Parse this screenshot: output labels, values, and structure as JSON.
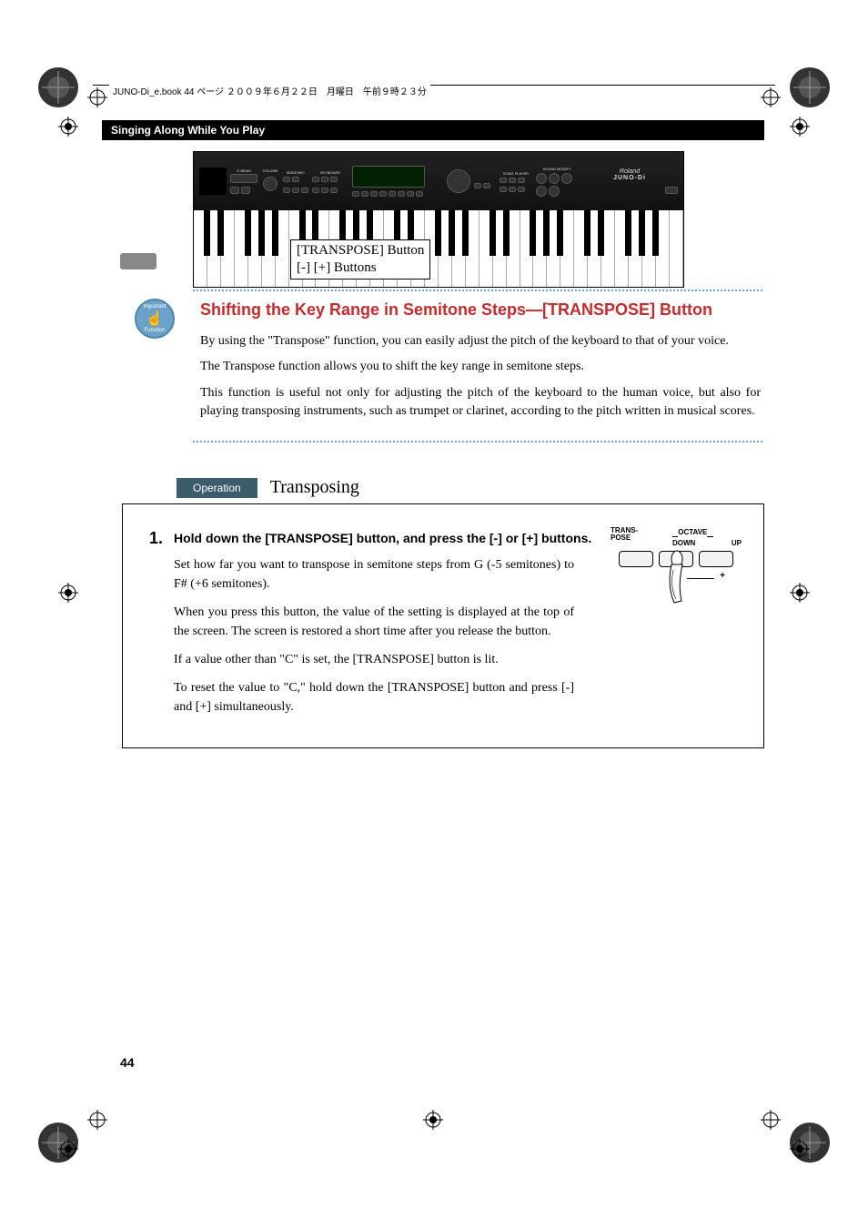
{
  "header": {
    "filename_line": "JUNO-Di_e.book  44 ページ  ２００９年６月２２日　月曜日　午前９時２３分",
    "section_bar": "Singing Along While You Play"
  },
  "figure": {
    "callout_line1": "[TRANSPOSE] Button",
    "callout_line2": "[-] [+] Buttons",
    "panel_labels": {
      "dbeam": "D BEAM",
      "volume": "VOLUME",
      "modemic": "MODE/MIC",
      "keyboard": "KEYBOARD",
      "songplayer": "SONG PLAYER",
      "soundmodify": "SOUND MODIFY",
      "brand": "Roland",
      "model": "JUNO-Di"
    }
  },
  "important_icon": {
    "top": "Important",
    "bottom": "Function"
  },
  "section_title": "Shifting the Key Range in Semitone Steps—[TRANSPOSE] Button",
  "paragraphs": {
    "p1": "By using the \"Transpose\" function, you can easily adjust the pitch of the keyboard to that of your voice.",
    "p2": "The Transpose function allows you to shift the key range in semitone steps.",
    "p3": "This function is useful not only for adjusting the pitch of the keyboard to the human voice, but also for playing transposing instruments, such as trumpet or clarinet, according to the pitch written in musical scores."
  },
  "operation": {
    "badge": "Operation",
    "title": "Transposing"
  },
  "step1": {
    "num": "1.",
    "heading": "Hold down the [TRANSPOSE] button, and press the [-] or [+] buttons.",
    "p1": "Set how far you want to transpose in semitone steps from G (-5 semitones) to F# (+6 semitones).",
    "p2": "When you press this button, the value of the setting is displayed at the top of the screen. The screen is restored a short time after you release the button.",
    "p3": "If a value other than \"C\" is set, the [TRANSPOSE] button is lit.",
    "p4": "To reset the value to \"C,\" hold down the [TRANSPOSE] button and press [-] and [+] simultaneously."
  },
  "illus": {
    "transpose": "TRANS-\nPOSE",
    "octave": "OCTAVE",
    "down": "DOWN",
    "up": "UP",
    "minus": "–",
    "plus": "+"
  },
  "page_number": "44"
}
